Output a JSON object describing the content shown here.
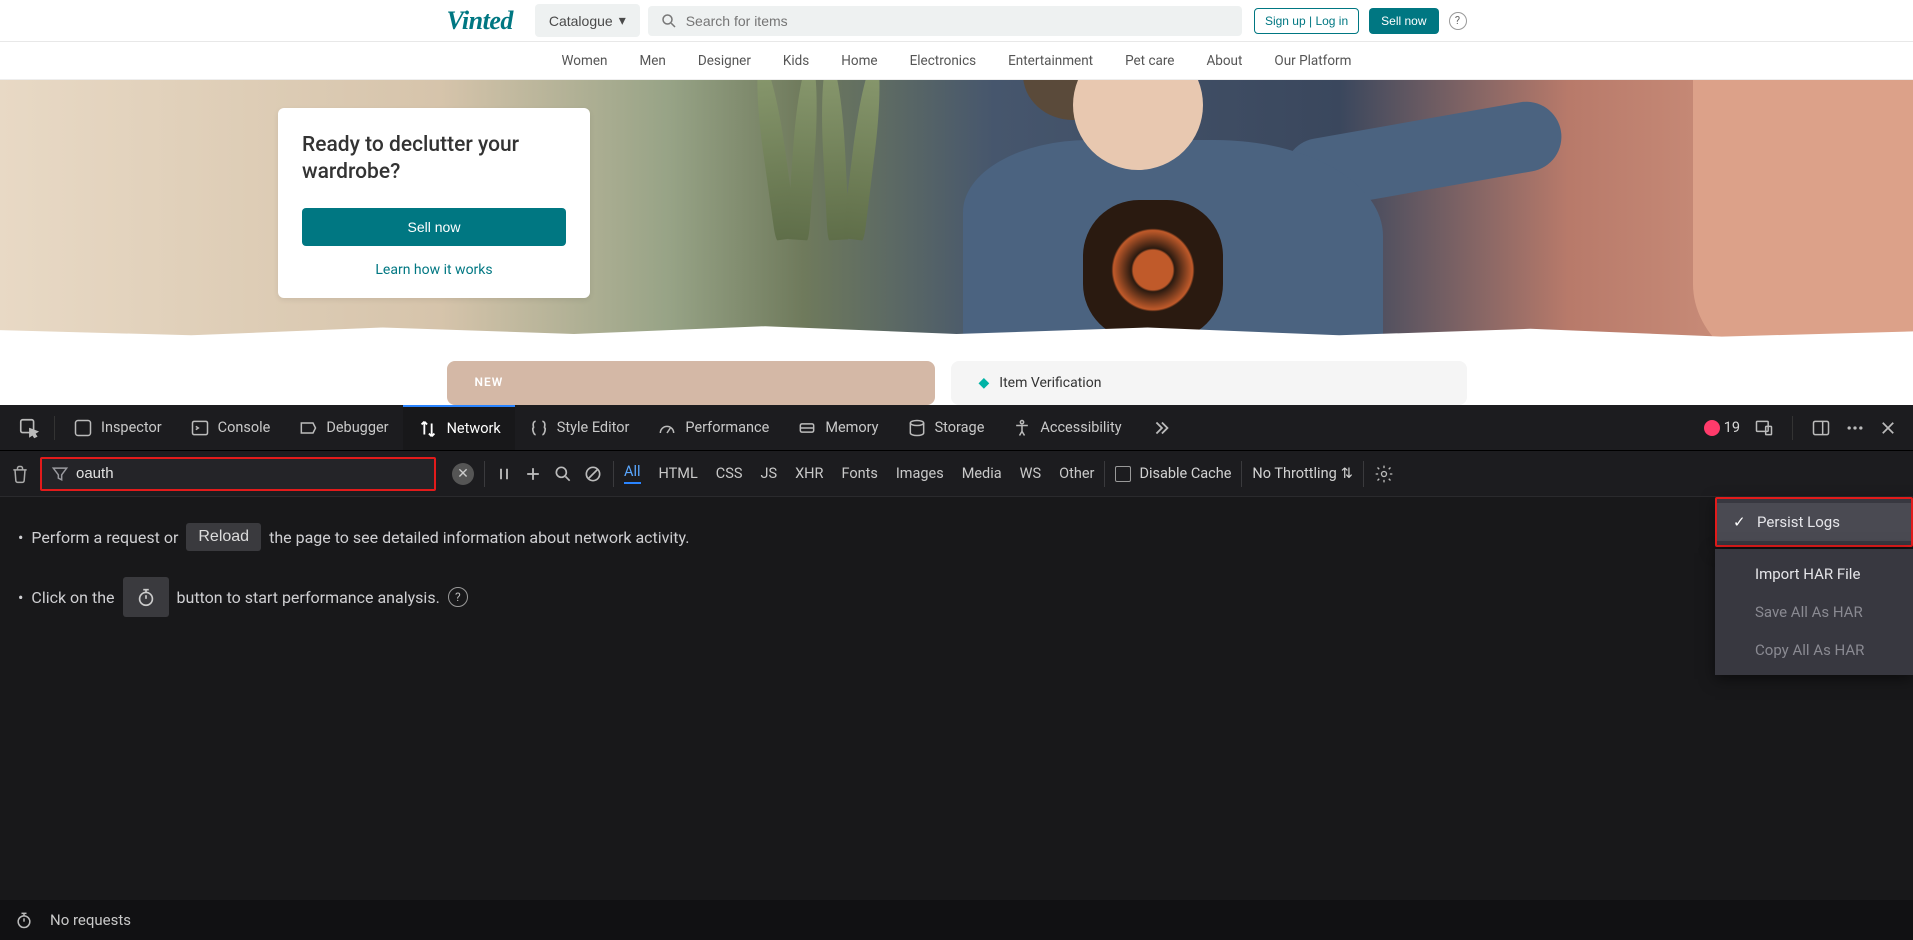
{
  "vinted": {
    "logo": "Vinted",
    "catalogue": "Catalogue",
    "search_placeholder": "Search for items",
    "signup_login": "Sign up | Log in",
    "sell_now": "Sell now",
    "help": "?",
    "nav": [
      "Women",
      "Men",
      "Designer",
      "Kids",
      "Home",
      "Electronics",
      "Entertainment",
      "Pet care",
      "About",
      "Our Platform"
    ],
    "hero_title_l1": "Ready to declutter your",
    "hero_title_l2": "wardrobe?",
    "hero_cta": "Sell now",
    "hero_link": "Learn how it works",
    "promo_new": "NEW",
    "promo_verify": "Item Verification"
  },
  "devtools": {
    "tabs": {
      "inspector": "Inspector",
      "console": "Console",
      "debugger": "Debugger",
      "network": "Network",
      "style": "Style Editor",
      "performance": "Performance",
      "memory": "Memory",
      "storage": "Storage",
      "accessibility": "Accessibility"
    },
    "errors": "19",
    "filter_value": "oauth",
    "types": {
      "all": "All",
      "html": "HTML",
      "css": "CSS",
      "js": "JS",
      "xhr": "XHR",
      "fonts": "Fonts",
      "images": "Images",
      "media": "Media",
      "ws": "WS",
      "other": "Other"
    },
    "disable_cache": "Disable Cache",
    "throttling": "No Throttling",
    "hint1_a": "Perform a request or",
    "hint1_reload": "Reload",
    "hint1_b": "the page to see detailed information about network activity.",
    "hint2_a": "Click on the",
    "hint2_b": "button to start performance analysis.",
    "menu": {
      "persist": "Persist Logs",
      "import": "Import HAR File",
      "save": "Save All As HAR",
      "copy": "Copy All As HAR"
    },
    "footer": "No requests"
  }
}
